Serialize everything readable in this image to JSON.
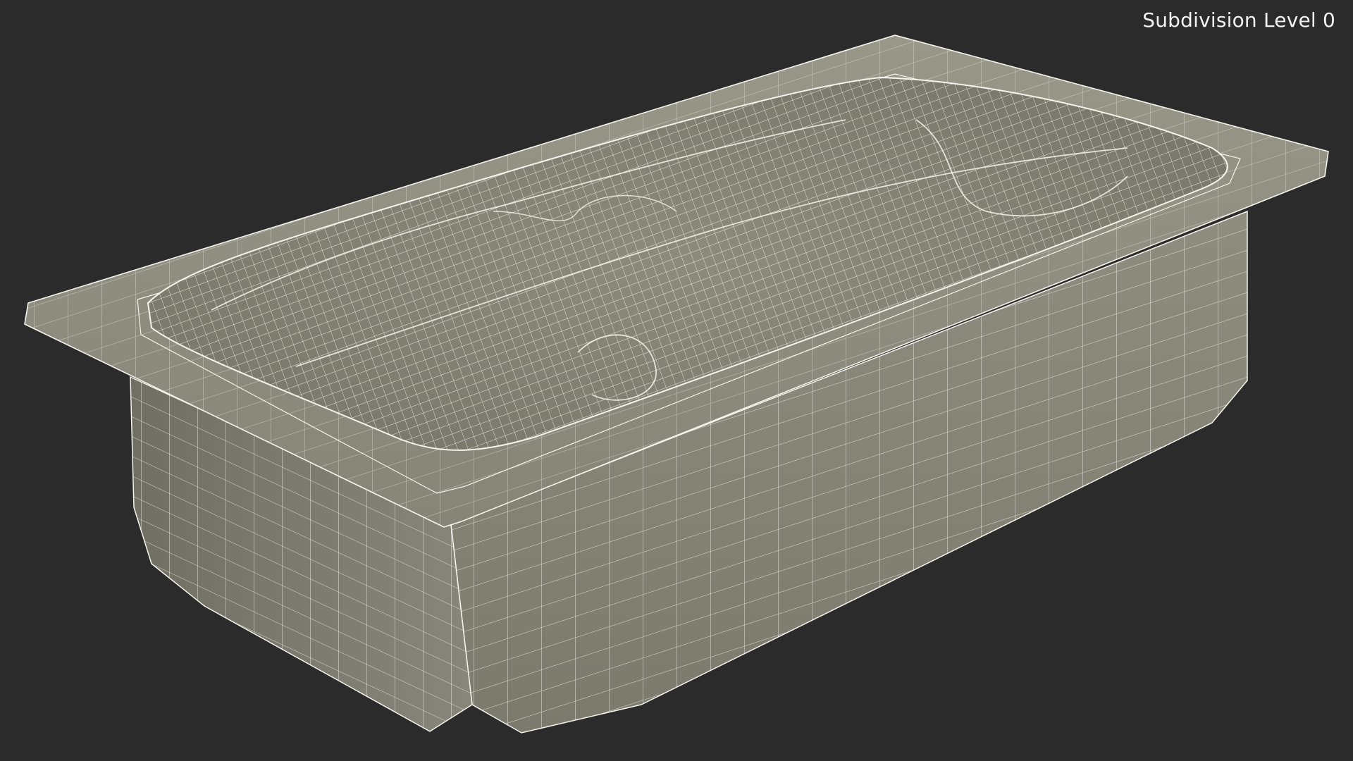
{
  "viewport": {
    "label": "Subdivision Level 0",
    "background": "#2b2b2b"
  },
  "model": {
    "icon": "bathtub-wireframe",
    "surface_color": "#8a8a7c",
    "wire_color": "#f4f4ec"
  }
}
